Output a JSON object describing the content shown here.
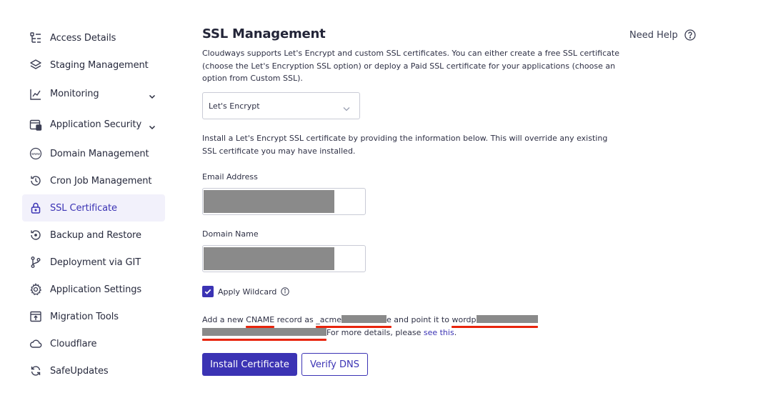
{
  "sidebar": {
    "items": [
      {
        "label": "Access Details",
        "icon": "access-details-icon"
      },
      {
        "label": "Staging Management",
        "icon": "layers-icon"
      },
      {
        "label": "Monitoring",
        "icon": "chart-line-icon",
        "expandable": true
      },
      {
        "label": "Application Security",
        "icon": "security-icon",
        "expandable": true
      },
      {
        "label": "Domain Management",
        "icon": "www-icon"
      },
      {
        "label": "Cron Job Management",
        "icon": "history-icon"
      },
      {
        "label": "SSL Certificate",
        "icon": "lock-icon",
        "active": true
      },
      {
        "label": "Backup and Restore",
        "icon": "restore-icon"
      },
      {
        "label": "Deployment via GIT",
        "icon": "git-branch-icon"
      },
      {
        "label": "Application Settings",
        "icon": "gear-icon"
      },
      {
        "label": "Migration Tools",
        "icon": "migration-icon"
      },
      {
        "label": "Cloudflare",
        "icon": "cloud-icon"
      },
      {
        "label": "SafeUpdates",
        "icon": "refresh-icon"
      }
    ]
  },
  "header": {
    "title": "SSL Management",
    "help_label": "Need Help"
  },
  "main": {
    "description": "Cloudways supports Let's Encrypt and custom SSL certificates. You can either create a free SSL certificate (choose the Let's Encryption SSL option) or deploy a Paid SSL certificate for your applications (choose an option from Custom SSL).",
    "ssl_type_selected": "Let's Encrypt",
    "install_info": "Install a Let's Encrypt SSL certificate by providing the information below. This will override any existing SSL certificate you may have installed.",
    "email_label": "Email Address",
    "domain_label": "Domain Name",
    "wildcard_label": "Apply Wildcard",
    "wildcard_checked": true,
    "cname": {
      "prefix": "Add a new ",
      "cname_word": "CNAME",
      "mid1": " record as ",
      "record_visible": "_acme",
      "record_tail": "e",
      "mid2": " and point it to ",
      "target_visible": "wordp",
      "details": "For more details, please ",
      "link": "see this",
      "end": "."
    },
    "install_button": "Install Certificate",
    "verify_button": "Verify DNS"
  },
  "colors": {
    "accent": "#3b33b4",
    "active_bg": "#f2f1fb",
    "redaction": "#8a8a8a",
    "annotation_red": "#e8240c"
  }
}
